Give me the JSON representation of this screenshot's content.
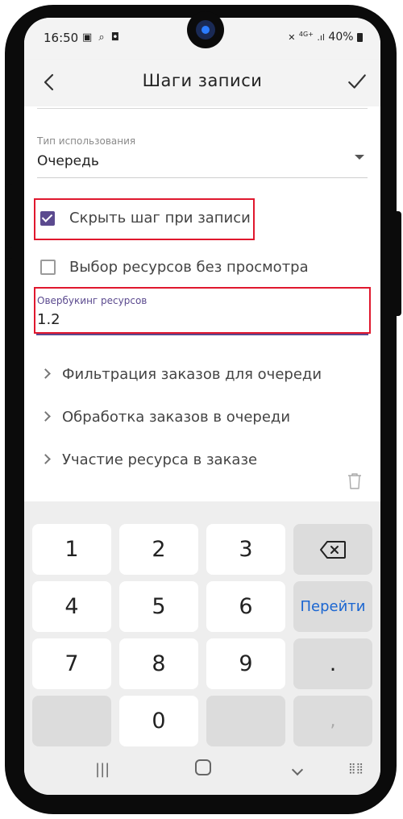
{
  "status_bar": {
    "time": "16:50",
    "battery": "40%",
    "network": "4G+"
  },
  "app_bar": {
    "title": "Шаги записи",
    "back_icon": "chevron-left-icon",
    "confirm_icon": "check-icon"
  },
  "form": {
    "usage_type": {
      "label": "Тип использования",
      "value": "Очередь"
    },
    "hide_step": {
      "label": "Скрыть шаг при записи",
      "checked": true
    },
    "resource_select": {
      "label": "Выбор ресурсов без просмотра",
      "checked": false
    },
    "overbooking": {
      "label": "Овербукинг ресурсов",
      "value": "1.2"
    }
  },
  "sections": [
    {
      "label": "Фильтрация заказов для очереди"
    },
    {
      "label": "Обработка заказов в очереди"
    },
    {
      "label": "Участие ресурса в заказе"
    }
  ],
  "keyboard": {
    "keys": [
      "1",
      "2",
      "3",
      "4",
      "5",
      "6",
      "7",
      "8",
      "9",
      "0",
      ".",
      ","
    ],
    "go_label": "Перейти",
    "backspace_icon": "backspace-icon"
  },
  "colors": {
    "accent": "#5b4a8f",
    "highlight": "#e0182e",
    "go": "#1b66d1"
  }
}
